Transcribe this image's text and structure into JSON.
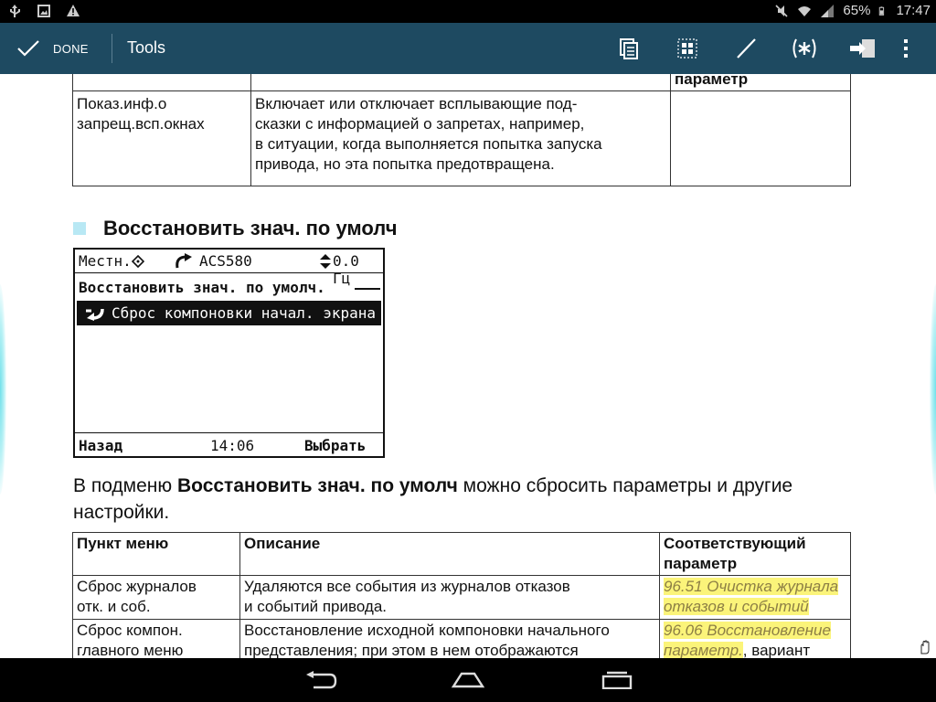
{
  "status_bar": {
    "battery": "65%",
    "time": "17:47",
    "left_icons": [
      "usb-icon",
      "image-icon",
      "warning-icon"
    ],
    "right_icons": [
      "mute-icon",
      "wifi-icon",
      "signal-icon",
      "battery-icon"
    ]
  },
  "toolbar": {
    "done_label": "DONE",
    "title": "Tools",
    "actions": [
      "pages-icon",
      "grid-icon",
      "pen-icon",
      "asterisk-icon",
      "export-icon",
      "more-icon"
    ],
    "bg_color": "#1e4a61"
  },
  "table1": {
    "header_col3": "параметр",
    "row": {
      "col1": "Показ.инф.о\nзапрещ.всп.окнах",
      "col2": "Включает или отключает всплывающие под-\nсказки с информацией о запретах, например,\nв ситуации, когда выполняется попытка запуска\nпривода, но эта попытка предотвращена.",
      "col3": ""
    }
  },
  "section": {
    "title": "Восстановить знач. по умолч",
    "bullet_color": "#b8e8f4"
  },
  "lcd": {
    "mode": "Местн.",
    "drive": "ACS580",
    "freq": "0.0 Гц",
    "heading": "Восстановить знач. по умолч.",
    "selected_item": "Сброс компоновки начал. экрана",
    "back": "Назад",
    "clock": "14:06",
    "select": "Выбрать"
  },
  "paragraph": {
    "before": "В подменю ",
    "bold": "Восстановить знач. по умолч",
    "after": " можно сбросить параметры и другие настройки."
  },
  "table2": {
    "headers": [
      "Пункт меню",
      "Описание",
      "Соответствующий\nпараметр"
    ],
    "rows": [
      {
        "item": "Сброс журналов\nотк. и соб.",
        "desc": "Удаляются все события из журналов отказов\nи событий привода.",
        "param_ref": "96.51 Очистка журнала\nотказов и событий",
        "param_rest": ""
      },
      {
        "item": "Сброс компон.\nглавного меню",
        "desc": "Восстановление исходной компоновки начального\nпредставления; при этом в нем отображаются",
        "param_ref": "96.06 Восстановление\nпараметр.",
        "param_rest": ", вариант"
      }
    ],
    "highlight_color": "#fbf47a"
  }
}
